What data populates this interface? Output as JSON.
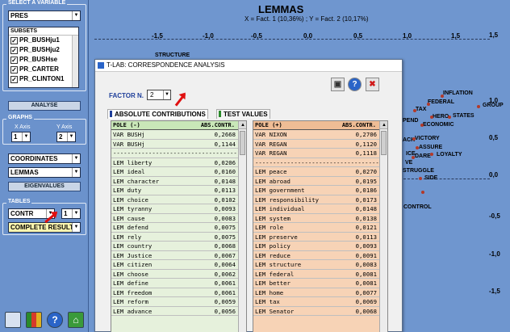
{
  "left_panel": {
    "select_title": "SELECT A VARIABLE",
    "variable": "PRES",
    "subsets_title": "SUBSETS",
    "subsets": [
      "PR_BUSHju1",
      "PR_BUSHju2",
      "PR_BUSHse",
      "PR_CARTER",
      "PR_CLINTON1"
    ],
    "analyse_button": "ANALYSE",
    "graphs_title": "GRAPHS",
    "x_axis_label": "X Axis",
    "y_axis_label": "Y Axis",
    "x_axis_value": "1",
    "y_axis_value": "2",
    "coordinates": "COORDINATES",
    "lemmas": "LEMMAS",
    "eigenvalues_button": "EIGENVALUES",
    "tables_title": "TABLES",
    "table_type": "CONTR",
    "table_num": "1",
    "complete_result": "COMPLETE RESULT"
  },
  "chart": {
    "title": "LEMMAS",
    "subtitle": "X = Fact. 1 (10,36%) ; Y = Fact. 2 (10,17%)",
    "x_ticks": [
      "-1,5",
      "-1,0",
      "-0,5",
      "0,0",
      "0,5",
      "1,0",
      "1,5"
    ],
    "y_ticks": [
      "1,5",
      "1,0",
      "0,5",
      "0,0",
      "-0,5",
      "-1,0",
      "-1,5"
    ],
    "labels": [
      "STRUCTURE",
      "INFLATION",
      "FEDERAL",
      "GROUP",
      "TAX",
      "HERO",
      "STATES",
      "PEND",
      "ECONOMIC",
      "VICTORY",
      "ACK",
      "ASSURE",
      "ICE",
      "DARE",
      "LOYALTY",
      "VE",
      "STRUGGLE",
      "SIDE",
      "CONTROL"
    ]
  },
  "dialog": {
    "title": "T-LAB: CORRESPONDENCE ANALYSIS",
    "factor_label": "FACTOR N.",
    "factor_value": "2",
    "tab_absolute": "ABSOLUTE CONTRIBUTIONS",
    "tab_test": "TEST VALUES",
    "neg_header": {
      "pole": "POLE (-)",
      "value": "ABS.CONTR."
    },
    "pos_header": {
      "pole": "POLE (+)",
      "value": "ABS.CONTR."
    },
    "neg_rows": [
      {
        "pole": "VAR BUSHj",
        "value": "0,2668"
      },
      {
        "pole": "VAR BUSHj",
        "value": "0,1144"
      },
      {
        "pole": "-----------------------------------",
        "value": ""
      },
      {
        "pole": "LEM liberty",
        "value": "0,0206"
      },
      {
        "pole": "LEM ideal",
        "value": "0,0160"
      },
      {
        "pole": "LEM character",
        "value": "0,0148"
      },
      {
        "pole": "LEM duty",
        "value": "0,0113"
      },
      {
        "pole": "LEM choice",
        "value": "0,0102"
      },
      {
        "pole": "LEM tyranny",
        "value": "0,0093"
      },
      {
        "pole": "LEM cause",
        "value": "0,0083"
      },
      {
        "pole": "LEM defend",
        "value": "0,0075"
      },
      {
        "pole": "LEM rely",
        "value": "0,0075"
      },
      {
        "pole": "LEM country",
        "value": "0,0068"
      },
      {
        "pole": "LEM Justice",
        "value": "0,0067"
      },
      {
        "pole": "LEM citizen",
        "value": "0,0064"
      },
      {
        "pole": "LEM choose",
        "value": "0,0062"
      },
      {
        "pole": "LEM define",
        "value": "0,0061"
      },
      {
        "pole": "LEM freedom",
        "value": "0,0061"
      },
      {
        "pole": "LEM reform",
        "value": "0,0059"
      },
      {
        "pole": "LEM advance",
        "value": "0,0056"
      }
    ],
    "pos_rows": [
      {
        "pole": "VAR NIXON",
        "value": "0,2706"
      },
      {
        "pole": "VAR REGAN",
        "value": "0,1120"
      },
      {
        "pole": "VAR REGAN",
        "value": "0,1118"
      },
      {
        "pole": "-----------------------------------",
        "value": ""
      },
      {
        "pole": "LEM peace",
        "value": "0,0270"
      },
      {
        "pole": "LEM abroad",
        "value": "0,0195"
      },
      {
        "pole": "LEM government",
        "value": "0,0186"
      },
      {
        "pole": "LEM responsibility",
        "value": "0,0173"
      },
      {
        "pole": "LEM individual",
        "value": "0,0148"
      },
      {
        "pole": "LEM system",
        "value": "0,0138"
      },
      {
        "pole": "LEM role",
        "value": "0,0121"
      },
      {
        "pole": "LEM preserve",
        "value": "0,0113"
      },
      {
        "pole": "LEM policy",
        "value": "0,0093"
      },
      {
        "pole": "LEM reduce",
        "value": "0,0091"
      },
      {
        "pole": "LEM structure",
        "value": "0,0083"
      },
      {
        "pole": "LEM federal",
        "value": "0,0081"
      },
      {
        "pole": "LEM better",
        "value": "0,0081"
      },
      {
        "pole": "LEM home",
        "value": "0,0077"
      },
      {
        "pole": "LEM tax",
        "value": "0,0069"
      },
      {
        "pole": "LEM Senator",
        "value": "0,0068"
      }
    ]
  },
  "colors": {
    "background": "#6f96cf",
    "neg_table": "#e6f1dc",
    "pos_table": "#f7d3b6",
    "accent_blue": "#1f3f9a",
    "arrow_red": "#e01010"
  }
}
